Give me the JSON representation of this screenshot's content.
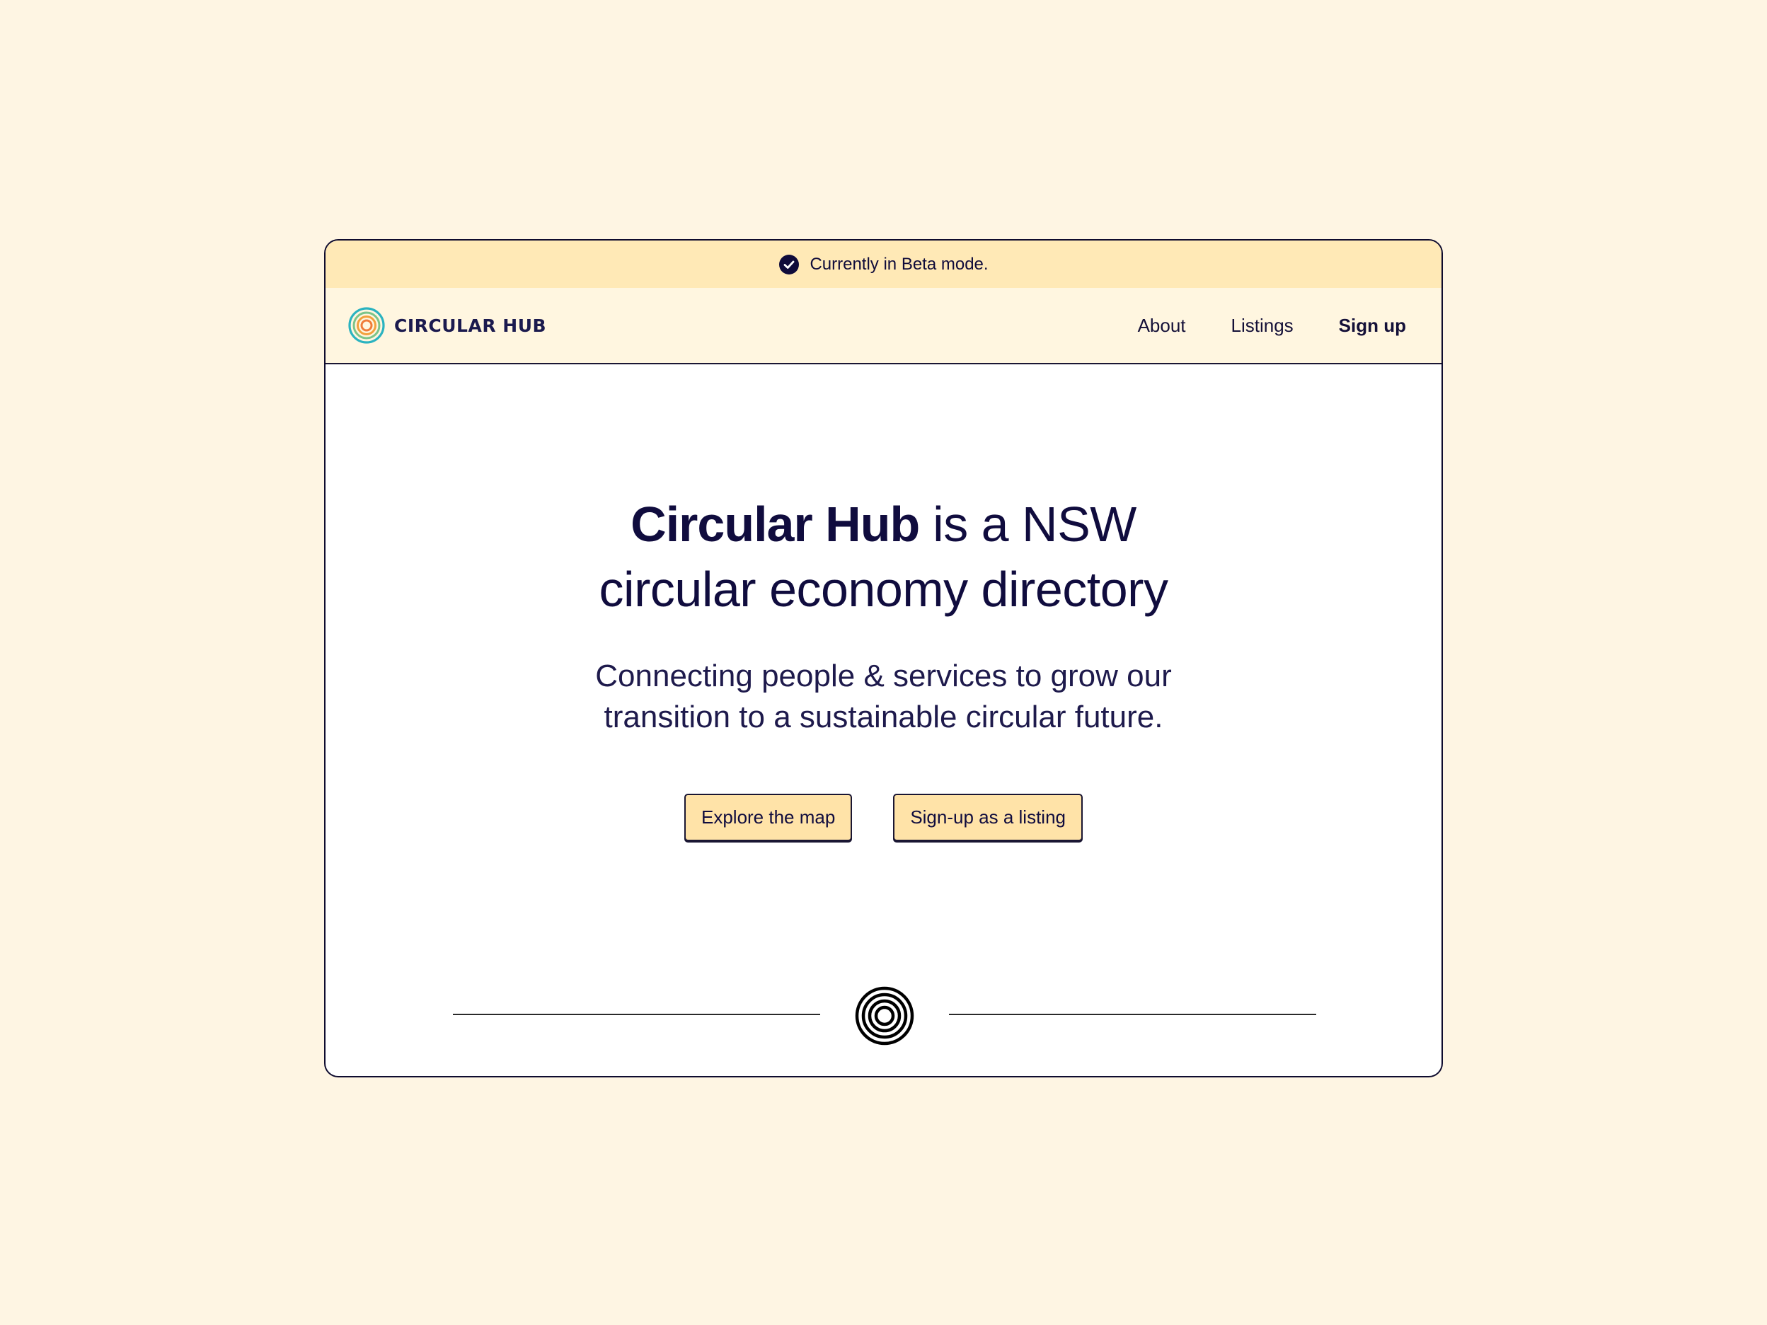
{
  "beta_banner": {
    "icon": "check-circle-icon",
    "text": "Currently in Beta mode."
  },
  "nav": {
    "brand": {
      "logo_icon": "concentric-circles-logo-icon",
      "name": "CIRCULAR HUB"
    },
    "links": [
      {
        "label": "About"
      },
      {
        "label": "Listings"
      },
      {
        "label": "Sign up"
      }
    ]
  },
  "hero": {
    "title_bold": "Circular Hub",
    "title_rest_line1": " is a NSW",
    "title_line2": "circular economy directory",
    "subtitle": "Connecting people & services to grow our transition to a sustainable circular future."
  },
  "cta": {
    "explore": "Explore the map",
    "signup_listing": "Sign-up as a listing"
  },
  "divider": {
    "icon": "concentric-circles-icon"
  },
  "colors": {
    "page_background": "#FEF5E3",
    "beta_bar": "#FFE9B6",
    "nav_background": "#FFF6E0",
    "button_fill": "#FFE3A8",
    "text_navy": "#100C3E",
    "logo_teal": "#2BB3C0",
    "logo_orange": "#F2A03D"
  }
}
